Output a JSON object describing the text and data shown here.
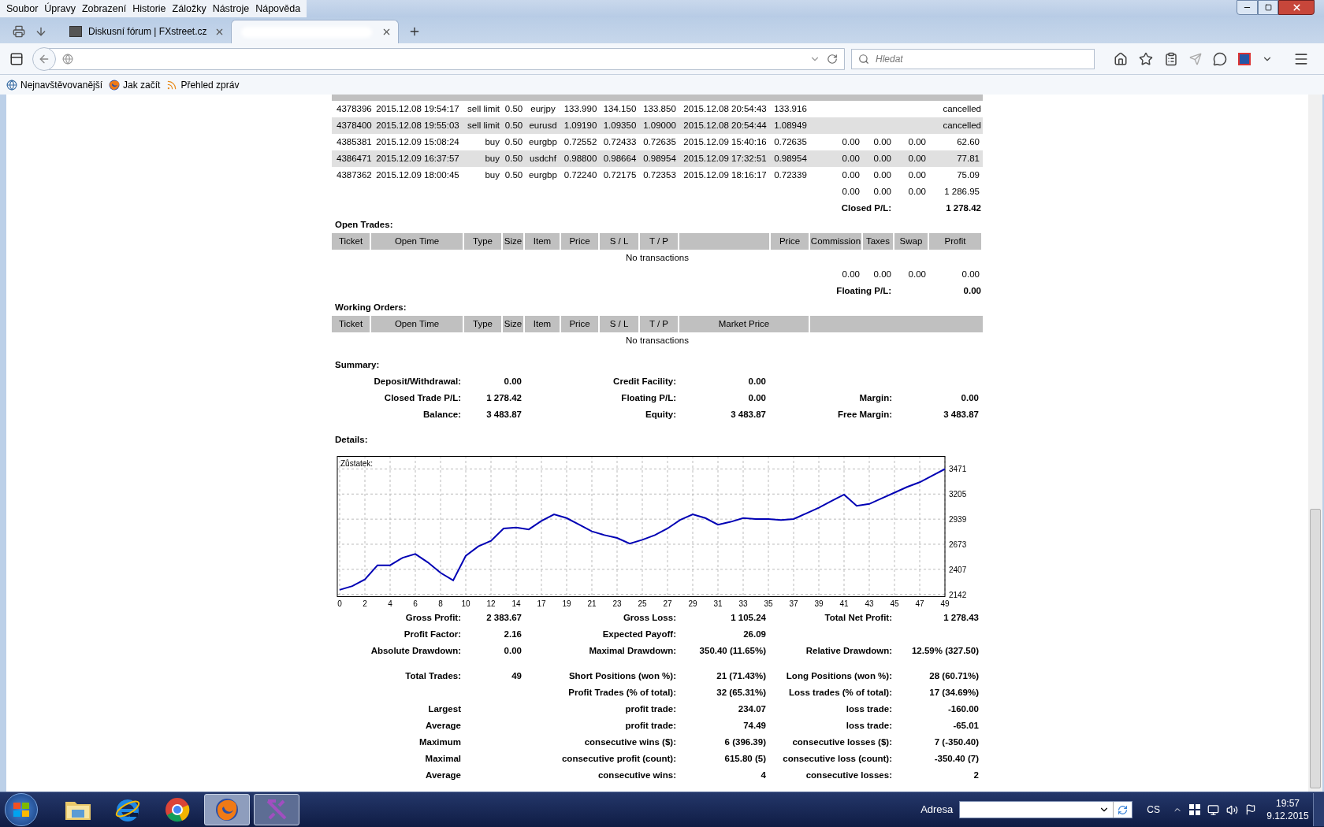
{
  "browser": {
    "menu": [
      "Soubor",
      "Úpravy",
      "Zobrazení",
      "Historie",
      "Záložky",
      "Nástroje",
      "Nápověda"
    ],
    "tabs": [
      {
        "title": "Diskusní fórum | FXstreet.cz",
        "selected": false
      },
      {
        "selected": true
      }
    ],
    "search": {
      "placeholder": "Hledat"
    },
    "bookmarks": [
      {
        "kind": "globe",
        "label": "Nejnavštěvovanější"
      },
      {
        "kind": "firefox",
        "label": "Jak začít"
      },
      {
        "kind": "rss",
        "label": "Přehled zpráv"
      }
    ]
  },
  "closed_trades": {
    "rows": [
      {
        "kind": "cancelled",
        "ticket": "4378396",
        "open_time": "2015.12.08 19:54:17",
        "type": "sell limit",
        "size": "0.50",
        "item": "eurjpy",
        "price": "133.990",
        "sl": "134.150",
        "tp": "133.850",
        "close_time": "2015.12.08 20:54:43",
        "close_price": "133.916",
        "status": "cancelled"
      },
      {
        "kind": "cancelled",
        "ticket": "4378400",
        "open_time": "2015.12.08 19:55:03",
        "type": "sell limit",
        "size": "0.50",
        "item": "eurusd",
        "price": "1.09190",
        "sl": "1.09350",
        "tp": "1.09000",
        "close_time": "2015.12.08 20:54:44",
        "close_price": "1.08949",
        "status": "cancelled"
      },
      {
        "kind": "closed",
        "ticket": "4385381",
        "open_time": "2015.12.09 15:08:24",
        "type": "buy",
        "size": "0.50",
        "item": "eurgbp",
        "price": "0.72552",
        "sl": "0.72433",
        "tp": "0.72635",
        "close_time": "2015.12.09 15:40:16",
        "close_price": "0.72635",
        "commission": "0.00",
        "taxes": "0.00",
        "swap": "0.00",
        "profit": "62.60"
      },
      {
        "kind": "closed",
        "ticket": "4386471",
        "open_time": "2015.12.09 16:37:57",
        "type": "buy",
        "size": "0.50",
        "item": "usdchf",
        "price": "0.98800",
        "sl": "0.98664",
        "tp": "0.98954",
        "close_time": "2015.12.09 17:32:51",
        "close_price": "0.98954",
        "commission": "0.00",
        "taxes": "0.00",
        "swap": "0.00",
        "profit": "77.81"
      },
      {
        "kind": "closed",
        "ticket": "4387362",
        "open_time": "2015.12.09 18:00:45",
        "type": "buy",
        "size": "0.50",
        "item": "eurgbp",
        "price": "0.72240",
        "sl": "0.72175",
        "tp": "0.72353",
        "close_time": "2015.12.09 18:16:17",
        "close_price": "0.72339",
        "commission": "0.00",
        "taxes": "0.00",
        "swap": "0.00",
        "profit": "75.09"
      }
    ],
    "totals": {
      "commission": "0.00",
      "taxes": "0.00",
      "swap": "0.00",
      "profit": "1 286.95"
    },
    "result": {
      "label": "Closed P/L:",
      "value": "1 278.42"
    }
  },
  "open_trades": {
    "title": "Open Trades:",
    "columns": [
      {
        "label": "Ticket"
      },
      {
        "label": "Open Time"
      },
      {
        "label": "Type"
      },
      {
        "label": "Size"
      },
      {
        "label": "Item"
      },
      {
        "label": "Price"
      },
      {
        "label": "S / L"
      },
      {
        "label": "T / P"
      },
      {
        "label": "Price"
      },
      {
        "label": "Commission"
      },
      {
        "label": "Taxes"
      },
      {
        "label": "Swap"
      },
      {
        "label": "Profit"
      }
    ],
    "empty_text": "No transactions",
    "totals": {
      "commission": "0.00",
      "taxes": "0.00",
      "swap": "0.00",
      "profit": "0.00"
    },
    "result": {
      "label": "Floating P/L:",
      "value": "0.00"
    }
  },
  "working_orders": {
    "title": "Working Orders:",
    "columns": [
      {
        "label": "Ticket"
      },
      {
        "label": "Open Time"
      },
      {
        "label": "Type"
      },
      {
        "label": "Size"
      },
      {
        "label": "Item"
      },
      {
        "label": "Price"
      },
      {
        "label": "S / L"
      },
      {
        "label": "T / P"
      },
      {
        "label": "Market Price"
      }
    ],
    "empty_text": "No transactions"
  },
  "summary": {
    "title": "Summary:",
    "rows": [
      {
        "left": {
          "label": "Deposit/Withdrawal:",
          "value": "0.00"
        },
        "middle": {
          "label": "Credit Facility:",
          "value": "0.00"
        }
      },
      {
        "left": {
          "label": "Closed Trade P/L:",
          "value": "1 278.42"
        },
        "middle": {
          "label": "Floating P/L:",
          "value": "0.00"
        },
        "right": {
          "label": "Margin:",
          "value": "0.00"
        }
      },
      {
        "left": {
          "label": "Balance:",
          "value": "3 483.87"
        },
        "middle": {
          "label": "Equity:",
          "value": "3 483.87"
        },
        "right": {
          "label": "Free Margin:",
          "value": "3 483.87"
        }
      }
    ]
  },
  "details": {
    "title": "Details:",
    "chart_data": {
      "type": "line",
      "title": "Zůstatek:",
      "categories": [
        "0",
        null,
        "2",
        null,
        "4",
        null,
        "6",
        null,
        "8",
        null,
        "10",
        null,
        "12",
        null,
        "14",
        null,
        "17",
        null,
        "19",
        null,
        "21",
        null,
        "23",
        null,
        "25",
        null,
        "27",
        null,
        "29",
        null,
        "31",
        null,
        "33",
        null,
        "35",
        null,
        "37",
        null,
        "39",
        null,
        "41",
        null,
        "43",
        null,
        "45",
        null,
        "47",
        null,
        "49"
      ],
      "series": [
        {
          "color": "#0000b4",
          "values": [
            2190,
            2230,
            2300,
            2450,
            2450,
            2530,
            2570,
            2480,
            2370,
            2290,
            2550,
            2650,
            2710,
            2840,
            2850,
            2830,
            2920,
            2990,
            2950,
            2880,
            2810,
            2770,
            2740,
            2680,
            2720,
            2770,
            2840,
            2930,
            2990,
            2950,
            2880,
            2910,
            2950,
            2940,
            2940,
            2930,
            2940,
            3000,
            3060,
            3130,
            3200,
            3080,
            3100,
            3160,
            3220,
            3280,
            3330,
            3400,
            3470
          ]
        }
      ],
      "grid": true,
      "ylim": [
        2142,
        3471
      ],
      "yticks": [
        2142,
        2407,
        2673,
        2939,
        3205,
        3471
      ]
    },
    "stat_groups": [
      [
        {
          "left": {
            "label": "Gross Profit:",
            "value": "2 383.67"
          },
          "middle": {
            "label": "Gross Loss:",
            "value": "1 105.24"
          },
          "right": {
            "label": "Total Net Profit:",
            "value": "1 278.43"
          }
        },
        {
          "left": {
            "label": "Profit Factor:",
            "value": "2.16"
          },
          "middle": {
            "label": "Expected Payoff:",
            "value": "26.09"
          }
        },
        {
          "left": {
            "label": "Absolute Drawdown:",
            "value": "0.00"
          },
          "middle": {
            "label": "Maximal Drawdown:",
            "value": "350.40 (11.65%)"
          },
          "right": {
            "label": "Relative Drawdown:",
            "value": "12.59% (327.50)"
          }
        }
      ],
      [
        {
          "left": {
            "label": "Total Trades:",
            "value": "49"
          },
          "middle": {
            "label": "Short Positions (won %):",
            "value": "21 (71.43%)"
          },
          "right": {
            "label": "Long Positions (won %):",
            "value": "28 (60.71%)"
          }
        },
        {
          "middle": {
            "label": "Profit Trades (% of total):",
            "value": "32 (65.31%)"
          },
          "right": {
            "label": "Loss trades (% of total):",
            "value": "17 (34.69%)"
          }
        },
        {
          "left": {
            "label": "Largest"
          },
          "middle": {
            "label": "profit trade:",
            "value": "234.07"
          },
          "right": {
            "label": "loss trade:",
            "value": "-160.00"
          }
        },
        {
          "left": {
            "label": "Average"
          },
          "middle": {
            "label": "profit trade:",
            "value": "74.49"
          },
          "right": {
            "label": "loss trade:",
            "value": "-65.01"
          }
        },
        {
          "left": {
            "label": "Maximum"
          },
          "middle": {
            "label": "consecutive wins ($):",
            "value": "6 (396.39)"
          },
          "right": {
            "label": "consecutive losses ($):",
            "value": "7 (-350.40)"
          }
        },
        {
          "left": {
            "label": "Maximal"
          },
          "middle": {
            "label": "consecutive profit (count):",
            "value": "615.80 (5)"
          },
          "right": {
            "label": "consecutive loss (count):",
            "value": "-350.40 (7)"
          }
        },
        {
          "left": {
            "label": "Average"
          },
          "middle": {
            "label": "consecutive wins:",
            "value": "4"
          },
          "right": {
            "label": "consecutive losses:",
            "value": "2"
          }
        }
      ]
    ]
  },
  "taskbar": {
    "apps": [
      {
        "kind": "folder",
        "selected": false,
        "running": false
      },
      {
        "kind": "ie",
        "selected": false,
        "running": false
      },
      {
        "kind": "chrome",
        "selected": false,
        "running": false
      },
      {
        "kind": "firefox",
        "selected": true,
        "running": true
      },
      {
        "kind": "xapp",
        "selected": false,
        "running": true
      }
    ],
    "address_label": "Adresa",
    "language": "CS",
    "time": "19:57",
    "date": "9.12.2015"
  }
}
